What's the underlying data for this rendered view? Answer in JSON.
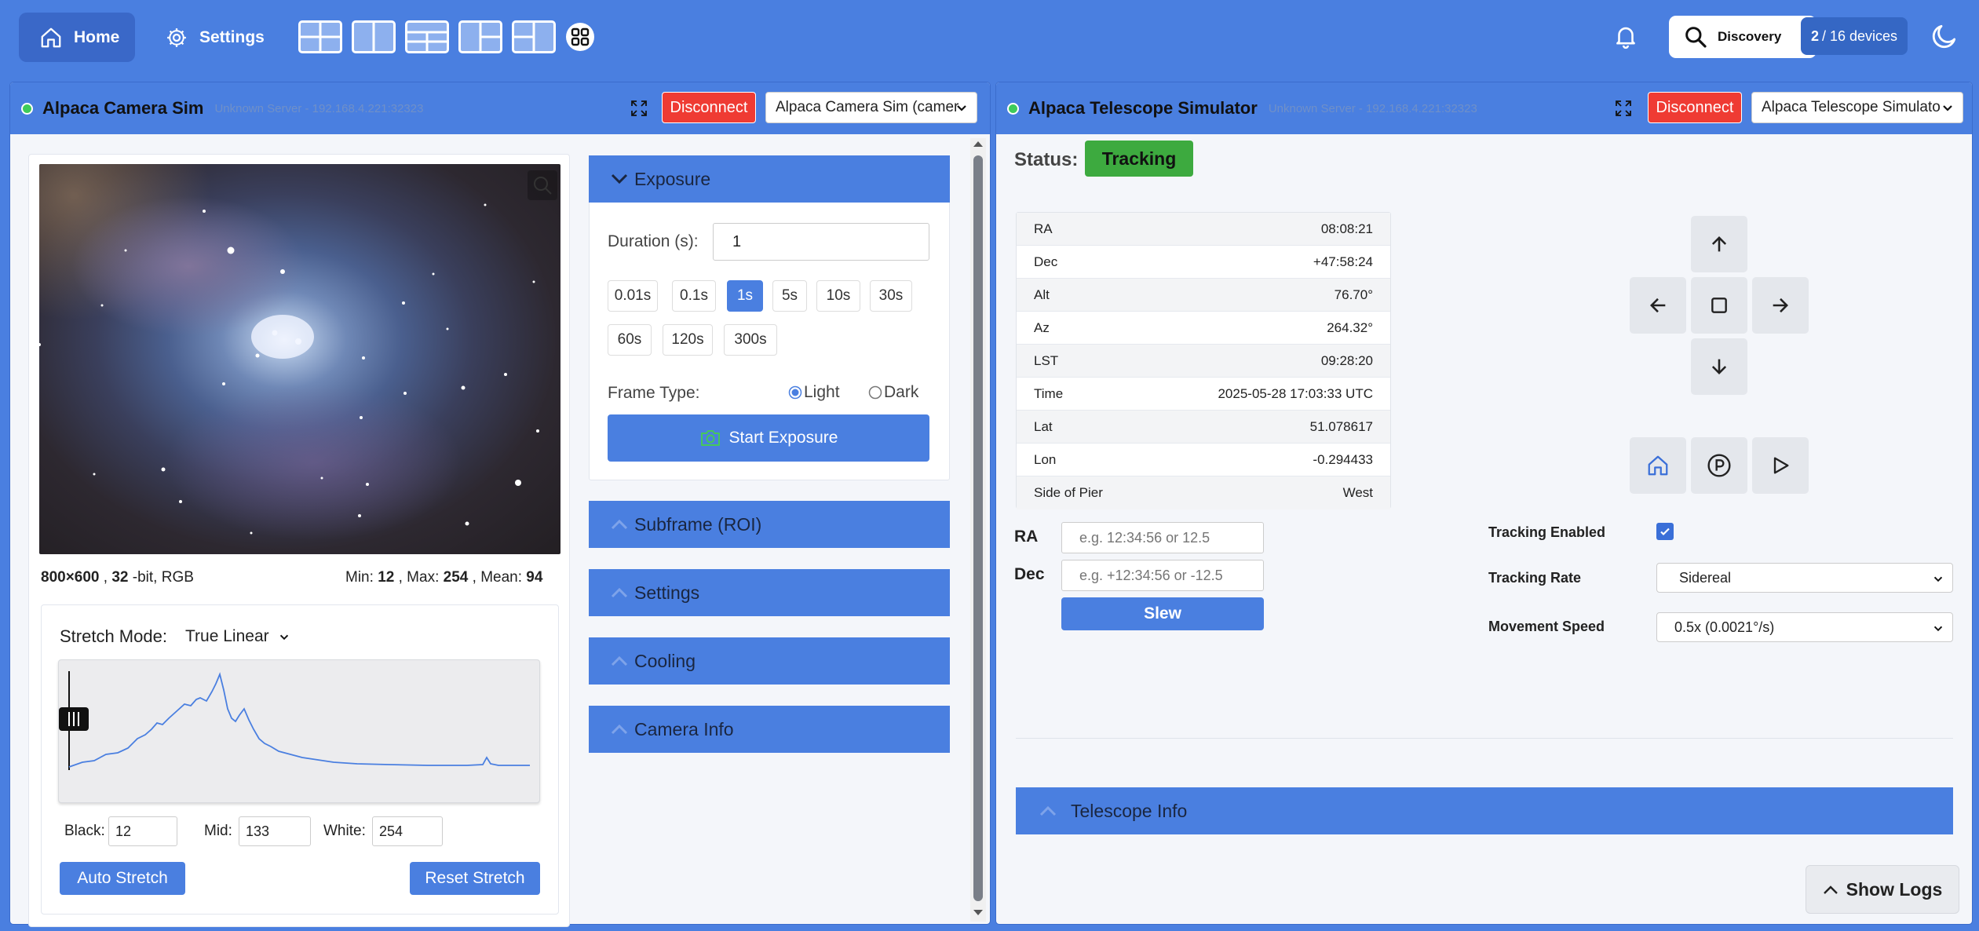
{
  "nav": {
    "home_label": "Home",
    "settings_label": "Settings",
    "discovery_label": "Discovery",
    "devices_count": "2",
    "devices_suffix": "/ 16 devices"
  },
  "camera": {
    "title": "Alpaca Camera Sim",
    "server": "Unknown Server - 192.168.4.221:32323",
    "disconnect_label": "Disconnect",
    "device_select": "Alpaca Camera Sim (camer",
    "image_info": {
      "size": "800×600",
      "bits": "32",
      "bits_suffix": "-bit, RGB",
      "min_label": "Min:",
      "min": "12",
      "max_label": "Max:",
      "max": "254",
      "mean_label": "Mean:",
      "mean": "94"
    },
    "stretch": {
      "mode_label": "Stretch Mode:",
      "mode_value": "True Linear",
      "black_label": "Black:",
      "black": "12",
      "mid_label": "Mid:",
      "mid": "133",
      "white_label": "White:",
      "white": "254",
      "auto_label": "Auto Stretch",
      "reset_label": "Reset Stretch"
    },
    "exposure": {
      "header": "Exposure",
      "duration_label": "Duration (s):",
      "duration_value": "1",
      "presets": [
        "0.01s",
        "0.1s",
        "1s",
        "5s",
        "10s",
        "30s",
        "60s",
        "120s",
        "300s"
      ],
      "selected_preset": "1s",
      "frame_type_label": "Frame Type:",
      "frame_light": "Light",
      "frame_dark": "Dark",
      "start_label": "Start Exposure"
    },
    "sections": [
      "Subframe (ROI)",
      "Settings",
      "Cooling",
      "Camera Info"
    ]
  },
  "telescope": {
    "title": "Alpaca Telescope Simulator",
    "server": "Unknown Server - 192.168.4.221:32323",
    "disconnect_label": "Disconnect",
    "device_select": "Alpaca Telescope Simulato",
    "status_label": "Status:",
    "status_value": "Tracking",
    "status_color": "#3daa3f",
    "coords": [
      {
        "label": "RA",
        "value": "08:08:21"
      },
      {
        "label": "Dec",
        "value": "+47:58:24"
      },
      {
        "label": "Alt",
        "value": "76.70°"
      },
      {
        "label": "Az",
        "value": "264.32°"
      },
      {
        "label": "LST",
        "value": "09:28:20"
      },
      {
        "label": "Time",
        "value": "2025-05-28 17:03:33 UTC"
      },
      {
        "label": "Lat",
        "value": "51.078617"
      },
      {
        "label": "Lon",
        "value": "-0.294433"
      },
      {
        "label": "Side of Pier",
        "value": "West"
      }
    ],
    "slew": {
      "ra_label": "RA",
      "ra_placeholder": "e.g. 12:34:56 or 12.5",
      "dec_label": "Dec",
      "dec_placeholder": "e.g. +12:34:56 or -12.5",
      "slew_label": "Slew"
    },
    "tracking_enabled_label": "Tracking Enabled",
    "tracking_enabled": true,
    "tracking_rate_label": "Tracking Rate",
    "tracking_rate_value": "Sidereal",
    "movement_speed_label": "Movement Speed",
    "movement_speed_value": "0.5x (0.0021°/s)",
    "info_header": "Telescope Info",
    "show_logs_label": "Show Logs"
  },
  "colors": {
    "accent": "#4a7fe0",
    "danger": "#ef3b33",
    "success": "#3daa3f"
  }
}
